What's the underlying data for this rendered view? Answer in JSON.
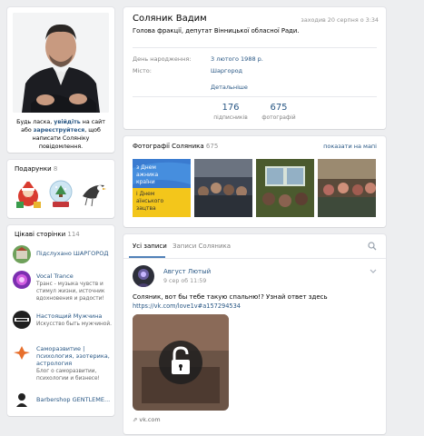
{
  "sidebar": {
    "login_note_prefix": "Будь ласка, ",
    "login_note_login": "увійдіть",
    "login_note_middle": " на сайт або ",
    "login_note_register": "зареєструйтеся",
    "login_note_suffix": ", щоб написати Соляніку повідомлення.",
    "gifts_title": "Подарунки",
    "gifts_count": "8",
    "pages_title": "Цікаві сторінки",
    "pages_count": "114",
    "pages": [
      {
        "name": "Підслухано ШАРГОРОД",
        "desc": ""
      },
      {
        "name": "Vocal Trance",
        "desc": "Транс - музыка чувств и стимул жизни, источник вдохновения и радости!"
      },
      {
        "name": "Настоящий Мужчина",
        "desc": "Искусство быть мужчиной."
      },
      {
        "name": "Саморазвитие | психология, эзотерика, астрология",
        "desc": "Блог о саморазвитии, психологии и бизнесе!"
      },
      {
        "name": "Barbershop GENTLEME...",
        "desc": ""
      }
    ]
  },
  "profile": {
    "name": "Соляник Вадим",
    "status": "Голова фракції, депутат Вінницької обласної Ради.",
    "last_seen": "заходив 20 серпня о 3:34",
    "birthday_label": "День народження:",
    "birthday_value": "3 лютого 1988 р.",
    "city_label": "Місто:",
    "city_value": "Шаргород",
    "details_link": "Детальніше",
    "subscribers_count": "176",
    "subscribers_label": "підписників",
    "photos_count": "675",
    "photos_label": "фотографій"
  },
  "photos": {
    "title": "Фотографії Соляника",
    "count": "675",
    "map_link": "показати на мапі",
    "banner_lines": [
      "з Днем",
      "ажника",
      "країни",
      "і Днем",
      "аїнського",
      "зацтва"
    ]
  },
  "wall": {
    "tab_all": "Усі записи",
    "tab_owner": "Записи Соляника",
    "post": {
      "author": "Август Лютый",
      "date": "9 сер об 11:59",
      "text": "Соляник, вот бы тебе такую спальню!? Узнай ответ здесь",
      "link": "https://vk.com/love1v#a157294534",
      "source": "vk.com"
    }
  },
  "colors": {
    "link": "#2a5885",
    "accent": "#5181b8",
    "background": "#edeef0"
  },
  "icons": [
    "search-icon",
    "chevron-down-icon",
    "lock-icon",
    "share-icon"
  ]
}
